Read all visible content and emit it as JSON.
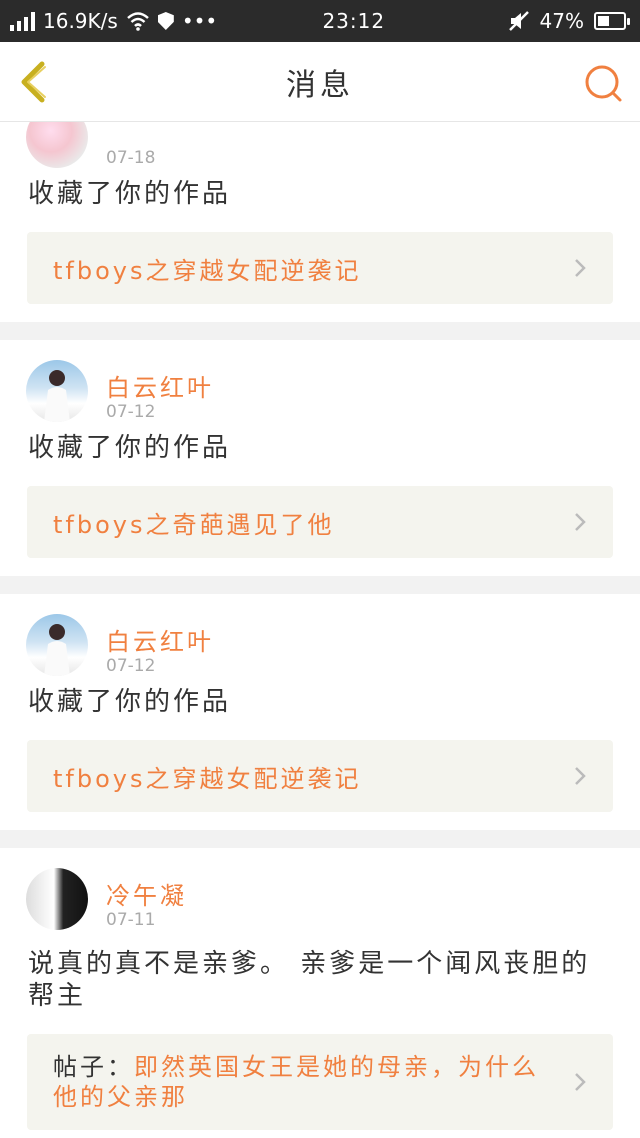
{
  "status_bar": {
    "speed": "16.9K/s",
    "dots": "•••",
    "time": "23:12",
    "battery_percent": "47%",
    "battery_level": 0.47
  },
  "nav": {
    "title": "消息",
    "back_icon": "chevron-left-icon",
    "search_icon": "search-icon",
    "accent_color": "#f08040"
  },
  "messages": [
    {
      "username": "",
      "date": "07-18",
      "text": "收藏了你的作品",
      "ref_prefix": "",
      "ref": "tfboys之穿越女配逆袭记"
    },
    {
      "username": "白云红叶",
      "date": "07-12",
      "text": "收藏了你的作品",
      "ref_prefix": "",
      "ref": "tfboys之奇葩遇见了他"
    },
    {
      "username": "白云红叶",
      "date": "07-12",
      "text": "收藏了你的作品",
      "ref_prefix": "",
      "ref": "tfboys之穿越女配逆袭记"
    },
    {
      "username": "冷午凝",
      "date": "07-11",
      "text": "说真的真不是亲爹。 亲爹是一个闻风丧胆的帮主",
      "ref_prefix": "帖子：",
      "ref": "即然英国女王是她的母亲，为什么他的父亲那"
    }
  ]
}
